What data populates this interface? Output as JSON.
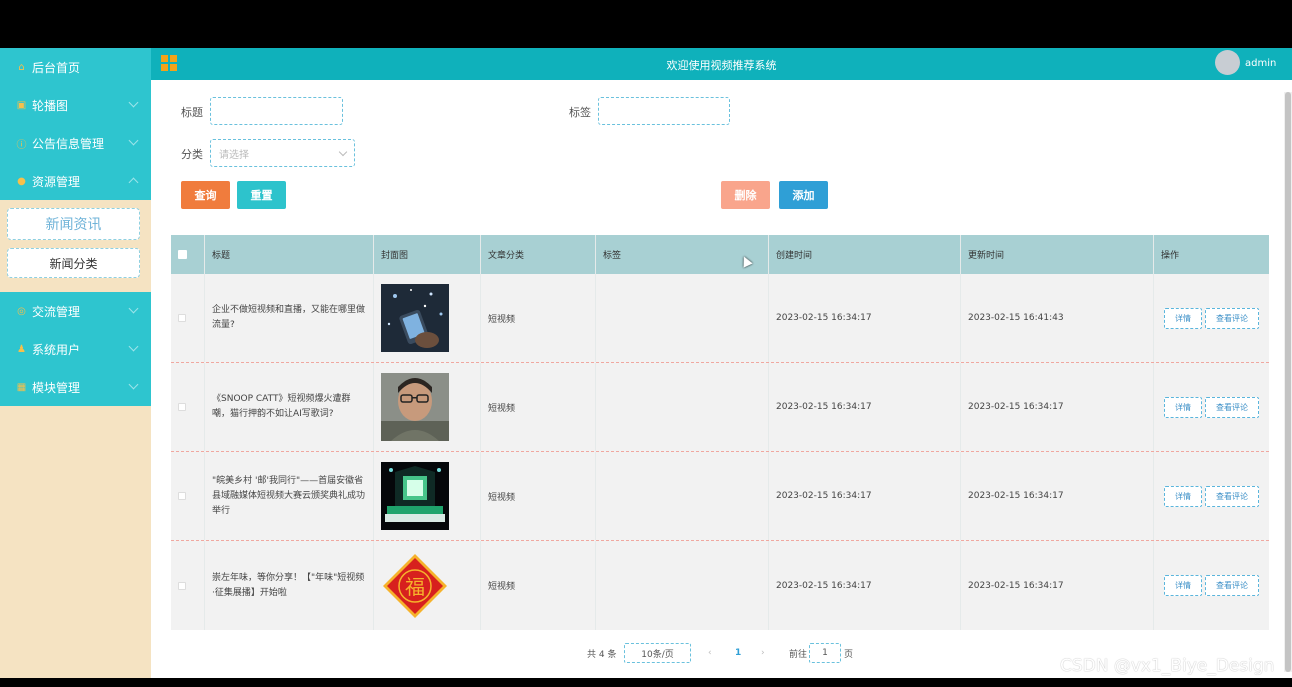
{
  "sidebar": {
    "items": [
      {
        "label": "后台首页",
        "icon": "home-icon",
        "glyph": "⌂",
        "expandable": false
      },
      {
        "label": "轮播图",
        "icon": "image-icon",
        "glyph": "▣",
        "expandable": true
      },
      {
        "label": "公告信息管理",
        "icon": "info-icon",
        "glyph": "ⓘ",
        "expandable": true
      },
      {
        "label": "资源管理",
        "icon": "location-icon",
        "glyph": "●",
        "expandable": true,
        "open": true
      },
      {
        "label": "交流管理",
        "icon": "chat-icon",
        "glyph": "◎",
        "expandable": true
      },
      {
        "label": "系统用户",
        "icon": "user-icon",
        "glyph": "♟",
        "expandable": true
      },
      {
        "label": "模块管理",
        "icon": "module-icon",
        "glyph": "▦",
        "expandable": true
      }
    ],
    "submenu": [
      "新闻资讯",
      "新闻分类"
    ]
  },
  "header": {
    "title": "欢迎使用视频推荐系统",
    "username": "admin"
  },
  "search": {
    "title_label": "标题",
    "tag_label": "标签",
    "category_label": "分类",
    "category_placeholder": "请选择",
    "query_button": "查询",
    "reset_button": "重置",
    "delete_button": "删除",
    "add_button": "添加"
  },
  "table": {
    "columns": [
      "标题",
      "封面图",
      "文章分类",
      "标签",
      "创建时间",
      "更新时间",
      "操作"
    ],
    "rows": [
      {
        "title": "企业不做短视频和直播，又能在哪里做流量?",
        "category": "短视频",
        "tag": "",
        "created": "2023-02-15 16:34:17",
        "updated": "2023-02-15 16:41:43",
        "cover": "phone-photo"
      },
      {
        "title": "《SNOOP CATT》短视频爆火遭群嘲，猫行押韵不如让AI写歌词?",
        "category": "短视频",
        "tag": "",
        "created": "2023-02-15 16:34:17",
        "updated": "2023-02-15 16:34:17",
        "cover": "boy-photo"
      },
      {
        "title": "\"皖美乡村 '邮'我同行\"——首届安徽省县域融媒体短视频大赛云颁奖典礼成功举行",
        "category": "短视频",
        "tag": "",
        "created": "2023-02-15 16:34:17",
        "updated": "2023-02-15 16:34:17",
        "cover": "stage-photo"
      },
      {
        "title": "崇左年味，等你分享！【\"年味\"短视频·征集展播】开始啦",
        "category": "短视频",
        "tag": "",
        "created": "2023-02-15 16:34:17",
        "updated": "2023-02-15 16:34:17",
        "cover": "fu-poster",
        "cover_text": "福"
      }
    ],
    "detail_button": "详情",
    "comment_button": "查看评论"
  },
  "pager": {
    "total": "共 4 条",
    "page_size": "10条/页",
    "prev": "‹",
    "current": "1",
    "next": "›",
    "goto_label": "前往",
    "goto_value": "1",
    "page_suffix": "页"
  },
  "watermark": "CSDN @vx1_Biye_Design",
  "colors": {
    "sidebar_menu": "#2ec5cf",
    "header": "#0fb1bb",
    "query": "#f07c3d",
    "reset": "#2dc3cc",
    "delete": "#f9a58c",
    "add": "#2f9fd6",
    "table_head": "#a8d0d3"
  }
}
